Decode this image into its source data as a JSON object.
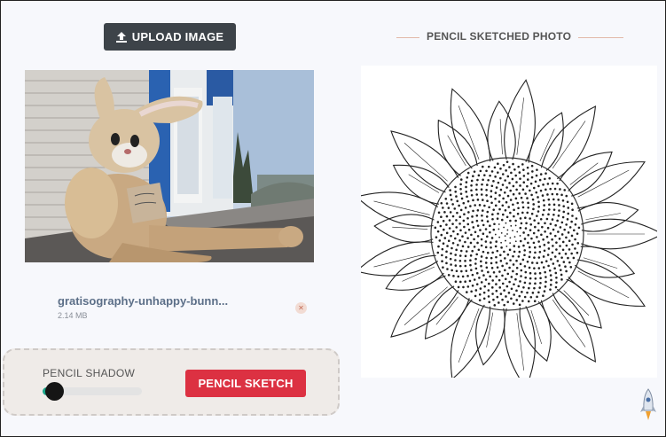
{
  "upload": {
    "label": "UPLOAD IMAGE",
    "icon": "upload-icon"
  },
  "file": {
    "name": "gratisography-unhappy-bunn...",
    "size": "2.14 MB",
    "remove_icon": "close-icon"
  },
  "controls": {
    "shadow_label": "PENCIL SHADOW",
    "shadow_level": 0.12,
    "sketch_label": "PENCIL SKETCH"
  },
  "result": {
    "title": "PENCIL SKETCHED PHOTO"
  },
  "colors": {
    "accent": "#dc3142",
    "dark_button": "#3d4349",
    "slider_fill": "#18a589"
  },
  "scroll_top_icon": "rocket-icon"
}
